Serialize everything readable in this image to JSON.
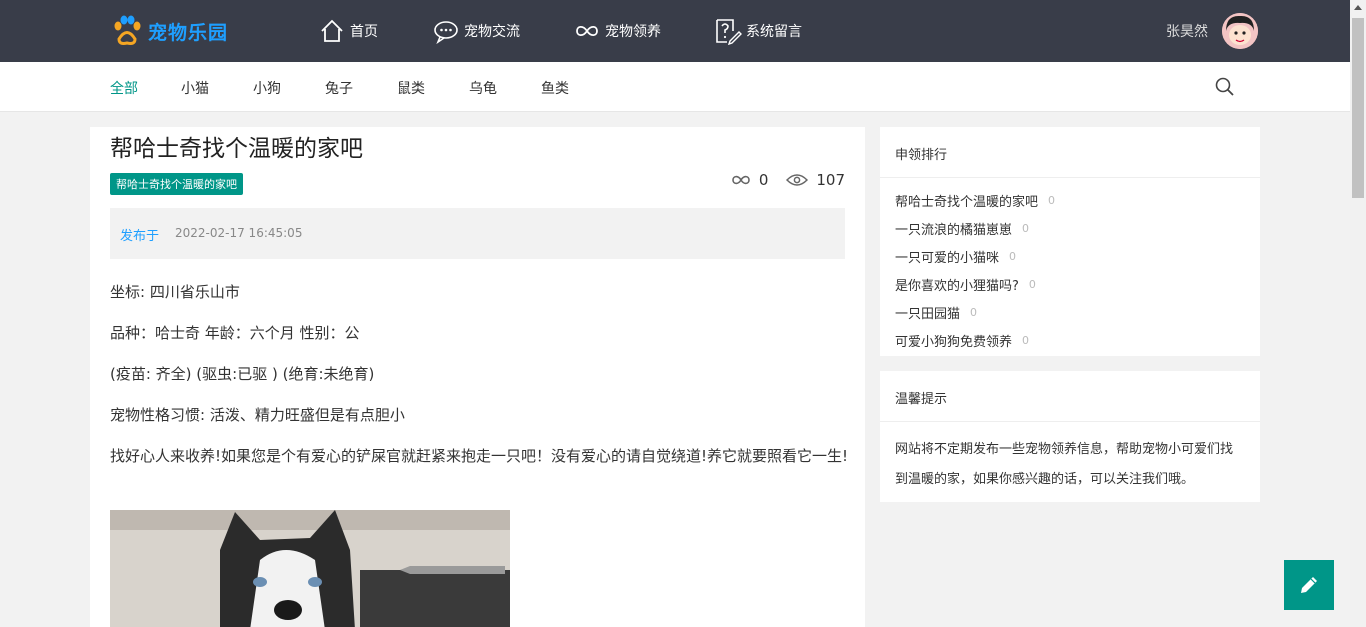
{
  "header": {
    "logo_text": "宠物乐园",
    "nav": [
      {
        "label": "首页",
        "icon": "home-icon"
      },
      {
        "label": "宠物交流",
        "icon": "chat-icon"
      },
      {
        "label": "宠物领养",
        "icon": "link-icon"
      },
      {
        "label": "系统留言",
        "icon": "message-icon"
      }
    ],
    "username": "张昊然"
  },
  "subnav": {
    "categories": [
      "全部",
      "小猫",
      "小狗",
      "兔子",
      "鼠类",
      "乌龟",
      "鱼类"
    ],
    "active_index": 0
  },
  "article": {
    "title": "帮哈士奇找个温暖的家吧",
    "tag": "帮哈士奇找个温暖的家吧",
    "likes": "0",
    "views": "107",
    "published_label": "发布于",
    "published_date": "2022-02-17 16:45:05",
    "paragraphs": [
      "坐标: 四川省乐山市",
      "品种：哈士奇 年龄：六个月 性别：公",
      "(疫苗: 齐全) (驱虫:已驱 ) (绝育:未绝育)",
      "宠物性格习惯: 活泼、精力旺盛但是有点胆小",
      "找好心人来收养!如果您是个有爱心的铲屎官就赶紧来抱走一只吧！没有爱心的请自觉绕道!养它就要照看它一生!"
    ]
  },
  "sidebar": {
    "rank_title": "申领排行",
    "rank_items": [
      {
        "title": "帮哈士奇找个温暖的家吧",
        "count": "0"
      },
      {
        "title": "一只流浪的橘猫崽崽",
        "count": "0"
      },
      {
        "title": "一只可爱的小猫咪",
        "count": "0"
      },
      {
        "title": "是你喜欢的小狸猫吗?",
        "count": "0"
      },
      {
        "title": "一只田园猫",
        "count": "0"
      },
      {
        "title": "可爱小狗狗免费领养",
        "count": "0"
      }
    ],
    "tips_title": "温馨提示",
    "tips_text": "网站将不定期发布一些宠物领养信息，帮助宠物小可爱们找到温暖的家，如果你感兴趣的话，可以关注我们哦。"
  },
  "colors": {
    "header_bg": "#393d49",
    "accent": "#009688",
    "brand": "#1e9fff"
  }
}
